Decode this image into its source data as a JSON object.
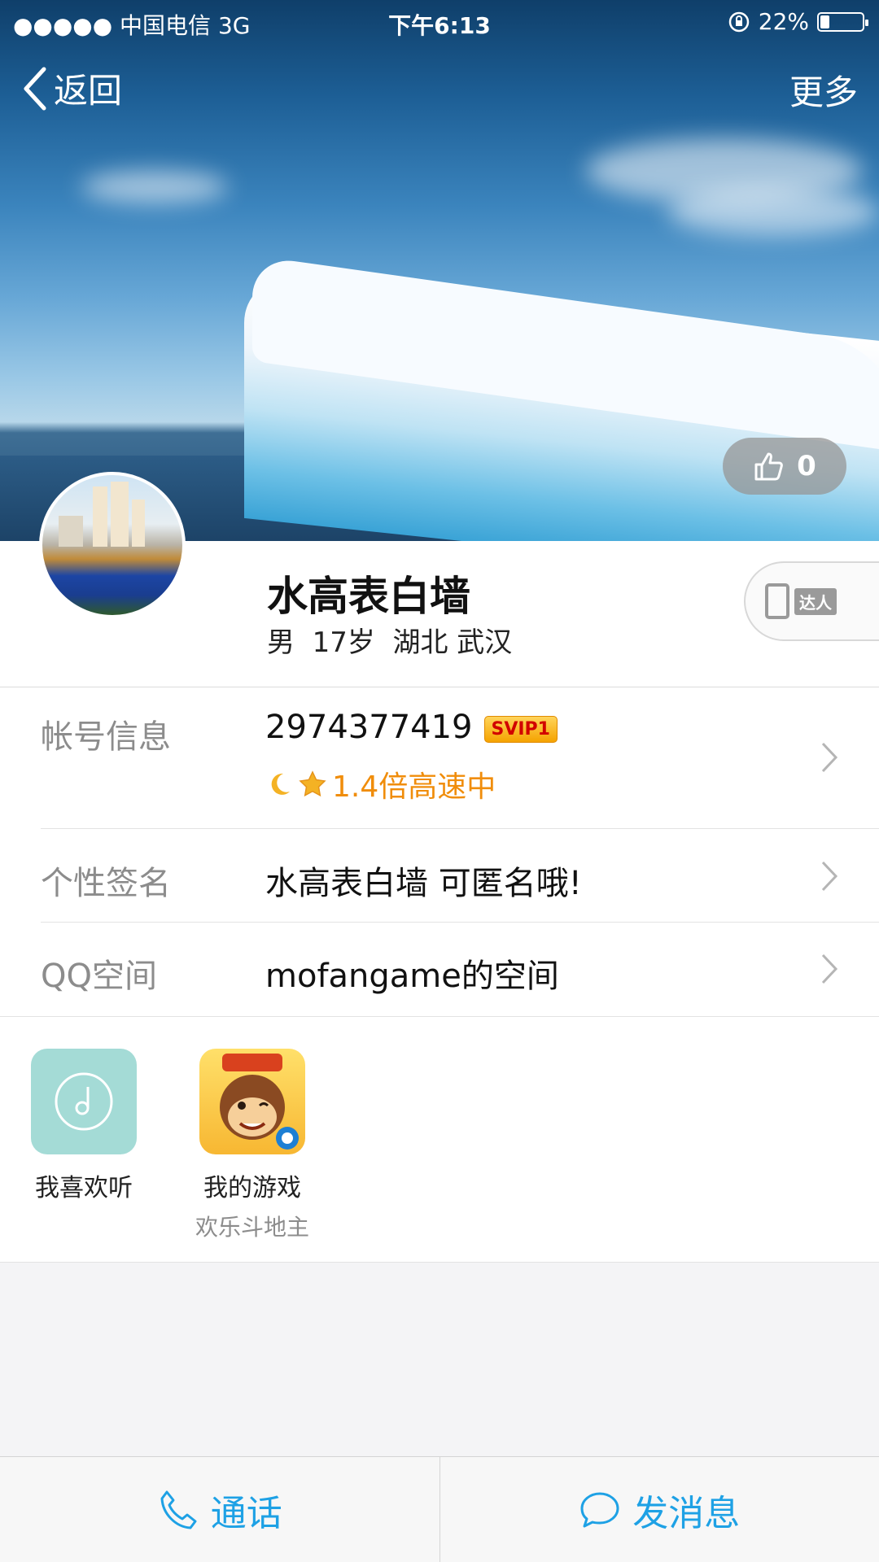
{
  "status_bar": {
    "carrier": "●●●●● 中国电信   3G",
    "time": "下午6:13",
    "battery": "22%",
    "battery_level": 0.22
  },
  "nav": {
    "back_label": "返回",
    "more_label": "更多"
  },
  "like": {
    "count": "0"
  },
  "profile": {
    "name": "水高表白墙",
    "meta": "男  17岁  湖北 武汉",
    "talent_tag": "达人"
  },
  "rows": [
    {
      "label": "帐号信息",
      "value": "2974377419",
      "badge": "SVIP1",
      "speed": "1.4倍高速中"
    },
    {
      "label": "个性签名",
      "value": "水高表白墙 可匿名哦!"
    },
    {
      "label": "QQ空间",
      "value": "mofangame的空间"
    }
  ],
  "apps": [
    {
      "label": "我喜欢听",
      "icon": "music-disc-icon",
      "color": "#a4dbd6"
    },
    {
      "label": "我的游戏",
      "sublabel": "欢乐斗地主",
      "icon": "game-monkey-icon"
    }
  ],
  "bottom": {
    "call_label": "通话",
    "message_label": "发消息"
  },
  "colors": {
    "accent": "#1ea1e5",
    "speed_orange": "#f08d0b",
    "label_gray": "#8c8c8c"
  }
}
